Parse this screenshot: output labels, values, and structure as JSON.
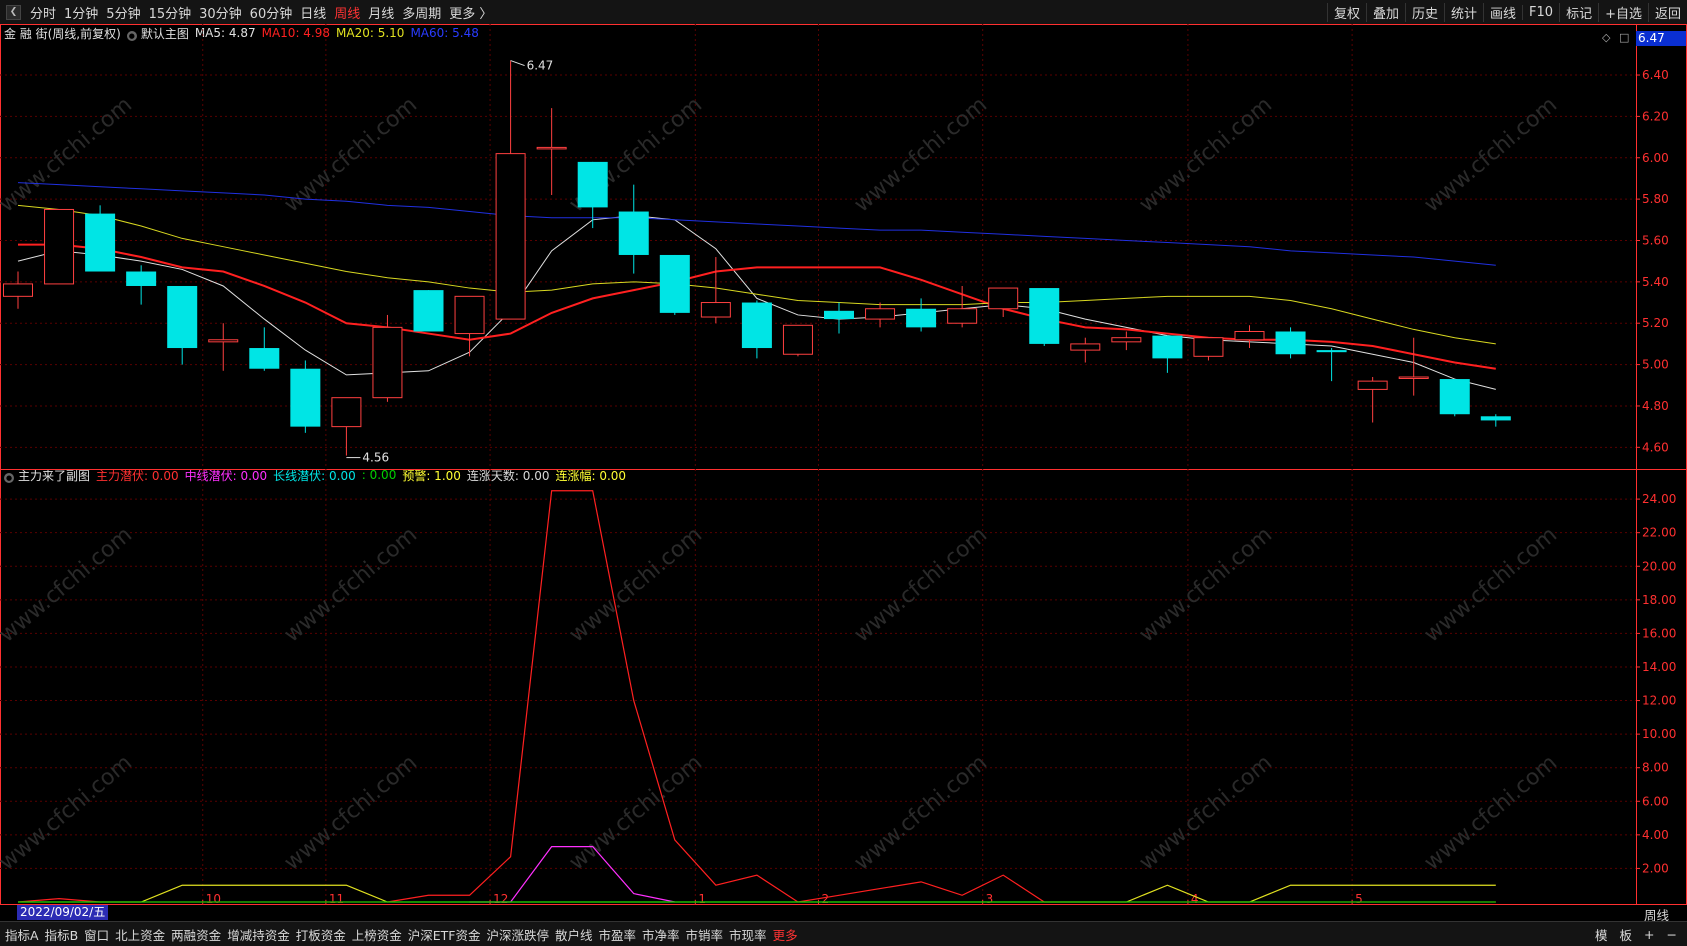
{
  "toolbar": {
    "periods": [
      {
        "label": "分时",
        "active": false
      },
      {
        "label": "1分钟",
        "active": false
      },
      {
        "label": "5分钟",
        "active": false
      },
      {
        "label": "15分钟",
        "active": false
      },
      {
        "label": "30分钟",
        "active": false
      },
      {
        "label": "60分钟",
        "active": false
      },
      {
        "label": "日线",
        "active": false
      },
      {
        "label": "周线",
        "active": true
      },
      {
        "label": "月线",
        "active": false
      },
      {
        "label": "多周期",
        "active": false
      },
      {
        "label": "更多 〉",
        "active": false
      }
    ],
    "tools": [
      "复权",
      "叠加",
      "历史",
      "统计",
      "画线",
      "F10",
      "标记",
      "+自选",
      "返回"
    ]
  },
  "main_legend": {
    "stock": "金 融 街(周线,前复权)",
    "template": "默认主图",
    "ma5": "MA5: 4.87",
    "ma10": "MA10: 4.98",
    "ma20": "MA20: 5.10",
    "ma60": "MA60: 5.48"
  },
  "sub_legend": {
    "name": "主力来了副图",
    "items": [
      {
        "text": "主力潜伏: 0.00",
        "color": "#ff3030"
      },
      {
        "text": "中线潜伏: 0.00",
        "color": "#ff30ff"
      },
      {
        "text": "长线潜伏: 0.00",
        "color": "#00e5e5"
      },
      {
        "text": ": 0.00",
        "color": "#00d000"
      },
      {
        "text": "预警: 1.00",
        "color": "#ffff33"
      },
      {
        "text": "连涨天数: 0.00",
        "color": "#d8d8d8"
      },
      {
        "text": "连涨幅: 0.00",
        "color": "#ffff33"
      }
    ]
  },
  "price_tag": "6.47",
  "max_label": "6.47",
  "min_label": "4.56",
  "first_date": "2022/09/02/五",
  "bottom_right_period": "周线",
  "bottom_tabs": [
    {
      "label": "指标A",
      "active": false
    },
    {
      "label": "指标B",
      "active": false
    },
    {
      "label": "窗口",
      "active": false
    },
    {
      "label": "北上资金",
      "active": false
    },
    {
      "label": "两融资金",
      "active": false
    },
    {
      "label": "增减持资金",
      "active": false
    },
    {
      "label": "打板资金",
      "active": false
    },
    {
      "label": "上榜资金",
      "active": false
    },
    {
      "label": "沪深ETF资金",
      "active": false
    },
    {
      "label": "沪深涨跌停",
      "active": false
    },
    {
      "label": "散户线",
      "active": false
    },
    {
      "label": "市盈率",
      "active": false
    },
    {
      "label": "市净率",
      "active": false
    },
    {
      "label": "市销率",
      "active": false
    },
    {
      "label": "市现率",
      "active": false
    },
    {
      "label": "更多",
      "active": true
    }
  ],
  "bottom_right": [
    "模",
    "板",
    "+",
    "−"
  ],
  "watermark": "www.cfchi.com",
  "colors": {
    "up": "#ff4040",
    "down": "#00e5e5",
    "ma5": "#e0e0e0",
    "ma10": "#ff2020",
    "ma20": "#d8d820",
    "ma60": "#2030e0",
    "grid": "#5a0000",
    "axis": "#ff3030"
  },
  "chart_data": [
    {
      "type": "candlestick",
      "name": "金 融 街(周线,前复权)",
      "y_ticks": [
        4.6,
        4.8,
        5.0,
        5.2,
        5.4,
        5.6,
        5.8,
        6.0,
        6.2,
        6.4
      ],
      "ylim": [
        4.5,
        6.55
      ],
      "x_ticks": [
        {
          "index": 5,
          "label": "10"
        },
        {
          "index": 8,
          "label": "11"
        },
        {
          "index": 12,
          "label": "12"
        },
        {
          "index": 17,
          "label": "1"
        },
        {
          "index": 20,
          "label": "2"
        },
        {
          "index": 24,
          "label": "3"
        },
        {
          "index": 29,
          "label": "4"
        },
        {
          "index": 33,
          "label": "5"
        }
      ],
      "candles": [
        {
          "o": 5.33,
          "c": 5.39,
          "h": 5.45,
          "l": 5.27
        },
        {
          "o": 5.39,
          "c": 5.75,
          "h": 5.75,
          "l": 5.39
        },
        {
          "o": 5.73,
          "c": 5.45,
          "h": 5.77,
          "l": 5.45
        },
        {
          "o": 5.45,
          "c": 5.38,
          "h": 5.48,
          "l": 5.29
        },
        {
          "o": 5.38,
          "c": 5.08,
          "h": 5.38,
          "l": 5.0
        },
        {
          "o": 5.11,
          "c": 5.12,
          "h": 5.2,
          "l": 4.97
        },
        {
          "o": 5.08,
          "c": 4.98,
          "h": 5.18,
          "l": 4.97
        },
        {
          "o": 4.98,
          "c": 4.7,
          "h": 5.02,
          "l": 4.67
        },
        {
          "o": 4.7,
          "c": 4.84,
          "h": 4.84,
          "l": 4.56
        },
        {
          "o": 4.84,
          "c": 5.18,
          "h": 5.24,
          "l": 4.82
        },
        {
          "o": 5.36,
          "c": 5.16,
          "h": 5.36,
          "l": 5.16
        },
        {
          "o": 5.15,
          "c": 5.33,
          "h": 5.33,
          "l": 5.04
        },
        {
          "o": 5.22,
          "c": 6.02,
          "h": 6.47,
          "l": 5.22
        },
        {
          "o": 6.05,
          "c": 6.05,
          "h": 6.24,
          "l": 5.82
        },
        {
          "o": 5.98,
          "c": 5.76,
          "h": 5.98,
          "l": 5.66
        },
        {
          "o": 5.74,
          "c": 5.53,
          "h": 5.87,
          "l": 5.44
        },
        {
          "o": 5.53,
          "c": 5.25,
          "h": 5.53,
          "l": 5.24
        },
        {
          "o": 5.23,
          "c": 5.3,
          "h": 5.52,
          "l": 5.2
        },
        {
          "o": 5.3,
          "c": 5.08,
          "h": 5.31,
          "l": 5.03
        },
        {
          "o": 5.05,
          "c": 5.19,
          "h": 5.19,
          "l": 5.04
        },
        {
          "o": 5.26,
          "c": 5.22,
          "h": 5.3,
          "l": 5.15
        },
        {
          "o": 5.22,
          "c": 5.27,
          "h": 5.3,
          "l": 5.18
        },
        {
          "o": 5.27,
          "c": 5.18,
          "h": 5.32,
          "l": 5.16
        },
        {
          "o": 5.2,
          "c": 5.27,
          "h": 5.38,
          "l": 5.18
        },
        {
          "o": 5.27,
          "c": 5.37,
          "h": 5.37,
          "l": 5.23
        },
        {
          "o": 5.37,
          "c": 5.1,
          "h": 5.37,
          "l": 5.09
        },
        {
          "o": 5.07,
          "c": 5.1,
          "h": 5.13,
          "l": 5.01
        },
        {
          "o": 5.11,
          "c": 5.13,
          "h": 5.16,
          "l": 5.07
        },
        {
          "o": 5.14,
          "c": 5.03,
          "h": 5.14,
          "l": 4.96
        },
        {
          "o": 5.04,
          "c": 5.13,
          "h": 5.13,
          "l": 5.02
        },
        {
          "o": 5.12,
          "c": 5.16,
          "h": 5.19,
          "l": 5.08
        },
        {
          "o": 5.16,
          "c": 5.05,
          "h": 5.18,
          "l": 5.03
        },
        {
          "o": 5.07,
          "c": 5.06,
          "h": 5.08,
          "l": 4.92
        },
        {
          "o": 4.88,
          "c": 4.92,
          "h": 4.94,
          "l": 4.72
        },
        {
          "o": 4.94,
          "c": 4.94,
          "h": 5.13,
          "l": 4.85
        },
        {
          "o": 4.93,
          "c": 4.76,
          "h": 4.93,
          "l": 4.75
        },
        {
          "o": 4.75,
          "c": 4.73,
          "h": 4.76,
          "l": 4.7
        }
      ],
      "ma": [
        {
          "name": "MA5",
          "color": "#e0e0e0",
          "width": 1,
          "values": [
            5.5,
            5.55,
            5.53,
            5.5,
            5.46,
            5.38,
            5.22,
            5.07,
            4.95,
            4.96,
            4.97,
            5.06,
            5.26,
            5.55,
            5.7,
            5.72,
            5.7,
            5.56,
            5.32,
            5.24,
            5.22,
            5.23,
            5.25,
            5.27,
            5.29,
            5.27,
            5.22,
            5.18,
            5.14,
            5.12,
            5.11,
            5.1,
            5.09,
            5.05,
            5.01,
            4.93,
            4.88
          ]
        },
        {
          "name": "MA10",
          "color": "#ff2020",
          "width": 2,
          "values": [
            5.58,
            5.58,
            5.56,
            5.52,
            5.47,
            5.45,
            5.38,
            5.3,
            5.2,
            5.18,
            5.15,
            5.12,
            5.15,
            5.25,
            5.32,
            5.36,
            5.4,
            5.45,
            5.47,
            5.47,
            5.47,
            5.47,
            5.41,
            5.34,
            5.27,
            5.22,
            5.18,
            5.17,
            5.15,
            5.13,
            5.12,
            5.12,
            5.11,
            5.09,
            5.05,
            5.01,
            4.98
          ]
        },
        {
          "name": "MA20",
          "color": "#d8d820",
          "width": 1,
          "values": [
            5.77,
            5.75,
            5.72,
            5.67,
            5.61,
            5.57,
            5.53,
            5.49,
            5.45,
            5.42,
            5.4,
            5.37,
            5.35,
            5.36,
            5.39,
            5.4,
            5.39,
            5.37,
            5.34,
            5.31,
            5.3,
            5.29,
            5.29,
            5.29,
            5.3,
            5.3,
            5.31,
            5.32,
            5.33,
            5.33,
            5.33,
            5.31,
            5.27,
            5.22,
            5.17,
            5.13,
            5.1
          ]
        },
        {
          "name": "MA60",
          "color": "#2030e0",
          "width": 1,
          "values": [
            5.88,
            5.87,
            5.86,
            5.85,
            5.84,
            5.83,
            5.82,
            5.8,
            5.79,
            5.77,
            5.76,
            5.74,
            5.72,
            5.71,
            5.71,
            5.71,
            5.7,
            5.69,
            5.68,
            5.67,
            5.66,
            5.65,
            5.65,
            5.64,
            5.63,
            5.62,
            5.61,
            5.6,
            5.59,
            5.58,
            5.57,
            5.55,
            5.54,
            5.53,
            5.52,
            5.5,
            5.48
          ]
        }
      ]
    },
    {
      "type": "line",
      "name": "主力来了副图",
      "y_ticks": [
        2,
        4,
        6,
        8,
        10,
        12,
        14,
        16,
        18,
        20,
        22,
        24
      ],
      "ylim": [
        0,
        24.9
      ],
      "series": [
        {
          "name": "主力潜伏",
          "color": "#ff2020",
          "values": [
            0,
            0.2,
            0,
            0,
            0,
            0,
            0,
            0,
            0,
            0,
            0.4,
            0.4,
            2.7,
            24.5,
            24.5,
            12.0,
            3.7,
            1.0,
            1.6,
            0,
            0.4,
            0.8,
            1.2,
            0.4,
            1.6,
            0,
            0,
            0,
            0,
            0,
            0,
            0,
            0,
            0,
            0,
            0,
            0
          ]
        },
        {
          "name": "中线潜伏",
          "color": "#ff30ff",
          "values": [
            null,
            null,
            null,
            null,
            null,
            null,
            null,
            null,
            null,
            null,
            null,
            0,
            0,
            3.3,
            3.3,
            0.5,
            0,
            null,
            null,
            null,
            null,
            null,
            null,
            null,
            null,
            null,
            null,
            null,
            null,
            null,
            null,
            null,
            null,
            null,
            null,
            null,
            null
          ]
        },
        {
          "name": "预警",
          "color": "#e0e020",
          "values": [
            0,
            0,
            0,
            0,
            1,
            1,
            1,
            1,
            1,
            0,
            0,
            0,
            0,
            0,
            0,
            0,
            0,
            0,
            0,
            0,
            0,
            0,
            0,
            0,
            0,
            0,
            0,
            0,
            1,
            0,
            0,
            1,
            1,
            1,
            1,
            1,
            1
          ]
        },
        {
          "name": "",
          "color": "#00c000",
          "values": [
            0,
            0,
            0,
            0,
            0,
            0,
            0,
            0,
            0,
            0,
            0,
            0,
            0,
            0,
            0,
            0,
            0,
            0,
            0,
            0,
            0,
            0,
            0,
            0,
            0,
            0,
            0,
            0,
            0,
            0,
            0,
            0,
            0,
            0,
            0,
            0,
            0
          ]
        }
      ]
    }
  ]
}
